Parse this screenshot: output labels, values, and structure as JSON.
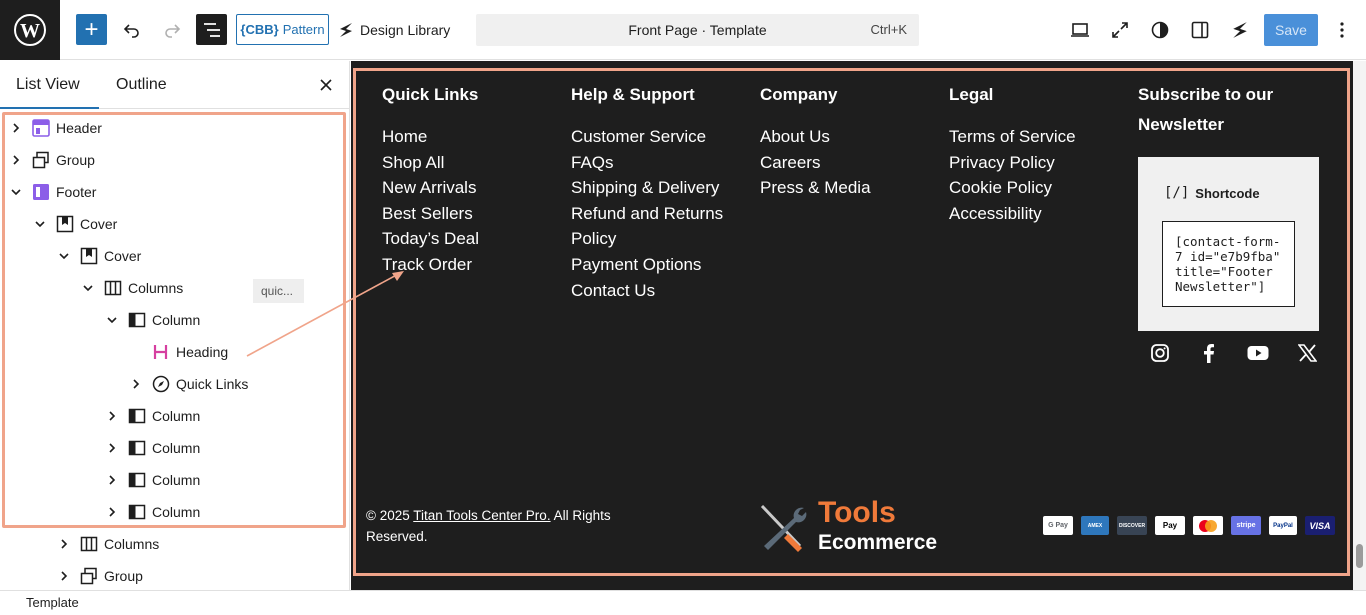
{
  "toolbar": {
    "add_label": "+",
    "pattern_prefix": "{CBB}",
    "pattern_label": "Pattern",
    "design_library": "Design Library",
    "command_title": "Front Page · Template",
    "command_shortcut": "Ctrl+K",
    "save_label": "Save"
  },
  "sidebar": {
    "tabs": [
      "List View",
      "Outline"
    ],
    "items": [
      {
        "label": "Header",
        "icon": "template-part-icon"
      },
      {
        "label": "Group",
        "icon": "group-icon"
      },
      {
        "label": "Footer",
        "icon": "template-part-icon"
      },
      {
        "label": "Cover",
        "icon": "cover-icon"
      },
      {
        "label": "Cover",
        "icon": "cover-icon"
      },
      {
        "label": "Columns",
        "icon": "columns-icon"
      },
      {
        "label": "Column",
        "icon": "column-icon"
      },
      {
        "label": "Heading",
        "icon": "heading-icon"
      },
      {
        "label": "Quick Links",
        "icon": "navigation-icon"
      },
      {
        "label": "Column",
        "icon": "column-icon"
      },
      {
        "label": "Column",
        "icon": "column-icon"
      },
      {
        "label": "Column",
        "icon": "column-icon"
      },
      {
        "label": "Column",
        "icon": "column-icon"
      },
      {
        "label": "Columns",
        "icon": "columns-icon"
      },
      {
        "label": "Group",
        "icon": "group-icon"
      }
    ],
    "heading_badge": "quic..."
  },
  "footer": {
    "columns": [
      {
        "heading": "Quick Links",
        "links": [
          "Home",
          "Shop All",
          "New Arrivals",
          "Best Sellers",
          "Today’s Deal",
          "Track Order"
        ]
      },
      {
        "heading": "Help & Support",
        "links": [
          "Customer Service",
          "FAQs",
          "Shipping & Delivery",
          "Refund and Returns",
          "Policy",
          "Payment Options",
          "Contact Us"
        ]
      },
      {
        "heading": "Company",
        "links": [
          "About Us",
          "Careers",
          "Press & Media"
        ]
      },
      {
        "heading": "Legal",
        "links": [
          "Terms of Service",
          "Privacy Policy",
          "Cookie Policy",
          "Accessibility"
        ]
      }
    ],
    "subscribe_heading_1": "Subscribe to our",
    "subscribe_heading_2": "Newsletter",
    "shortcode_label": "Shortcode",
    "shortcode_value": "[contact-form-7 id=\"e7b9fba\" title=\"Footer Newsletter\"]",
    "social": [
      "instagram-icon",
      "facebook-icon",
      "youtube-icon",
      "x-icon"
    ],
    "copyright_prefix": "© 2025",
    "copyright_link": "Titan Tools Center Pro.",
    "copyright_suffix": "All Rights Reserved.",
    "logo_line1": "Tools",
    "logo_line2": "Ecommerce",
    "payments": [
      "G Pay",
      "AMEX",
      "DISCOVER",
      "Pay",
      "mastercard",
      "stripe",
      "PayPal",
      "VISA"
    ]
  },
  "breadcrumb": "Template",
  "colors": {
    "accent": "#2271b1",
    "highlight": "#f0a48a",
    "canvas_bg": "#1e1e1e",
    "logo_orange": "#f07a3a"
  }
}
